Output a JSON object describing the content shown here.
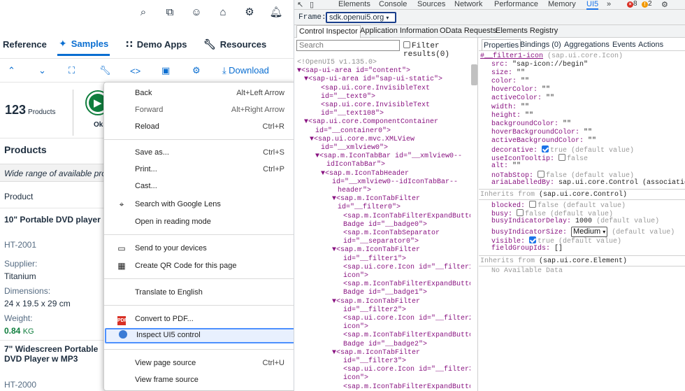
{
  "left": {
    "nav": {
      "reference": "Reference",
      "samples": "Samples",
      "demo_apps": "Demo Apps",
      "resources": "Resources"
    },
    "toolbar": {
      "download": "Download"
    },
    "count": {
      "value": "123",
      "label": "Products"
    },
    "status_label": "Ok",
    "products_title": "Products",
    "description": "Wide range of available pro",
    "column_header": "Product",
    "product1": {
      "name": "10\" Portable DVD player",
      "id": "HT-2001",
      "supplier_label": "Supplier:",
      "supplier": "Titanium",
      "dim_label": "Dimensions:",
      "dimensions": "24 x 19.5 x 29 cm",
      "weight_label": "Weight:",
      "weight_value": "0.84",
      "weight_unit": "KG"
    },
    "product2": {
      "name": "7\" Widescreen Portable DVD Player w MP3",
      "id": "HT-2000"
    }
  },
  "menu": {
    "back": "Back",
    "back_sc": "Alt+Left Arrow",
    "forward": "Forward",
    "forward_sc": "Alt+Right Arrow",
    "reload": "Reload",
    "reload_sc": "Ctrl+R",
    "save_as": "Save as...",
    "save_as_sc": "Ctrl+S",
    "print": "Print...",
    "print_sc": "Ctrl+P",
    "cast": "Cast...",
    "lens": "Search with Google Lens",
    "reading": "Open in reading mode",
    "send": "Send to your devices",
    "qr": "Create QR Code for this page",
    "translate": "Translate to English",
    "pdf": "Convert to PDF...",
    "inspect": "Inspect UI5 control",
    "view_source": "View page source",
    "view_source_sc": "Ctrl+U",
    "view_frame": "View frame source"
  },
  "devtools": {
    "tabs": [
      "Elements",
      "Console",
      "Sources",
      "Network",
      "Performance",
      "Memory",
      "UI5"
    ],
    "more": "»",
    "errors": "8",
    "warnings": "2",
    "frame_label": "Frame:",
    "frame_value": "sdk.openui5.org",
    "subtabs": [
      "Control Inspector",
      "Application Information",
      "OData Requests",
      "Elements Registry"
    ],
    "search_placeholder": "Search",
    "filter_label": "Filter results(0)",
    "right_tabs": [
      "Properties",
      "Bindings (0)",
      "Aggregations",
      "Events",
      "Actions"
    ],
    "tree": [
      "<!OpenUI5 v1.135.0>",
      "▼<sap-ui-area id=\"content\">",
      "▼<sap-ui-area id=\"sap-ui-static\">",
      "<sap.ui.core.InvisibleText",
      "id=\"__text0\">",
      "<sap.ui.core.InvisibleText",
      "id=\"__text108\">",
      "▼<sap.ui.core.ComponentContainer",
      "id=\"__container0\">",
      "▼<sap.ui.core.mvc.XMLView",
      "id=\"__xmlview0\">",
      "▼<sap.m.IconTabBar id=\"__xmlview0--",
      "idIconTabBar\">",
      "▼<sap.m.IconTabHeader",
      "id=\"__xmlview0--idIconTabBar--",
      "header\">",
      "▼<sap.m.IconTabFilter",
      "id=\"__filter0\">",
      "<sap.m.IconTabFilterExpandButton",
      "Badge id=\"__badge0\">",
      "<sap.m.IconTabSeparator",
      "id=\"__separator0\">",
      "▼<sap.m.IconTabFilter",
      "id=\"__filter1\">",
      "<sap.ui.core.Icon id=\"__filter1-",
      "icon\">",
      "<sap.m.IconTabFilterExpandButton",
      "Badge id=\"__badge1\">",
      "▼<sap.m.IconTabFilter",
      "id=\"__filter2\">",
      "<sap.ui.core.Icon id=\"__filter2-",
      "icon\">",
      "<sap.m.IconTabFilterExpandButton",
      "Badge id=\"__badge2\">",
      "▼<sap.m.IconTabFilter",
      "id=\"__filter3\">",
      "<sap.ui.core.Icon id=\"__filter3-",
      "icon\">",
      "<sap.m.IconTabFilterExpandButton"
    ],
    "props": {
      "header_id": "#__filter1-icon",
      "header_type": "(sap.ui.core.Icon)",
      "rows": [
        [
          "src:",
          "\"sap-icon://begin\""
        ],
        [
          "size:",
          "\"\""
        ],
        [
          "color:",
          "\"\""
        ],
        [
          "hoverColor:",
          "\"\""
        ],
        [
          "activeColor:",
          "\"\""
        ],
        [
          "width:",
          "\"\""
        ],
        [
          "height:",
          "\"\""
        ],
        [
          "backgroundColor:",
          "\"\""
        ],
        [
          "hoverBackgroundColor:",
          "\"\""
        ],
        [
          "activeBackgroundColor:",
          "\"\""
        ]
      ],
      "decorative": "decorative:",
      "decorative_val": "true (default value)",
      "tooltip": "useIconTooltip:",
      "tooltip_val": "false",
      "alt": "alt:",
      "alt_val": "\"\"",
      "notabstop": "noTabStop:",
      "notabstop_val": "false (default value)",
      "aria": "ariaLabelledBy:",
      "aria_val": "sap.ui.core.Control (associations)",
      "inherit1": "Inherits from",
      "inherit1_type": "(sap.ui.core.Control)",
      "blocked": "blocked:",
      "blocked_val": "false (default value)",
      "busy": "busy:",
      "busy_val": "false (default value)",
      "delay": "busyIndicatorDelay:",
      "delay_val": "1000",
      "delay_def": "(default value)",
      "bsize": "busyIndicatorSize:",
      "bsize_val": "Medium",
      "bsize_def": "(default value)",
      "visible": "visible:",
      "visible_val": "true (default value)",
      "fg": "fieldGroupIds:",
      "fg_val": "[]",
      "inherit2": "Inherits from",
      "inherit2_type": "(sap.ui.core.Element)",
      "no_data": "No Available Data"
    }
  }
}
